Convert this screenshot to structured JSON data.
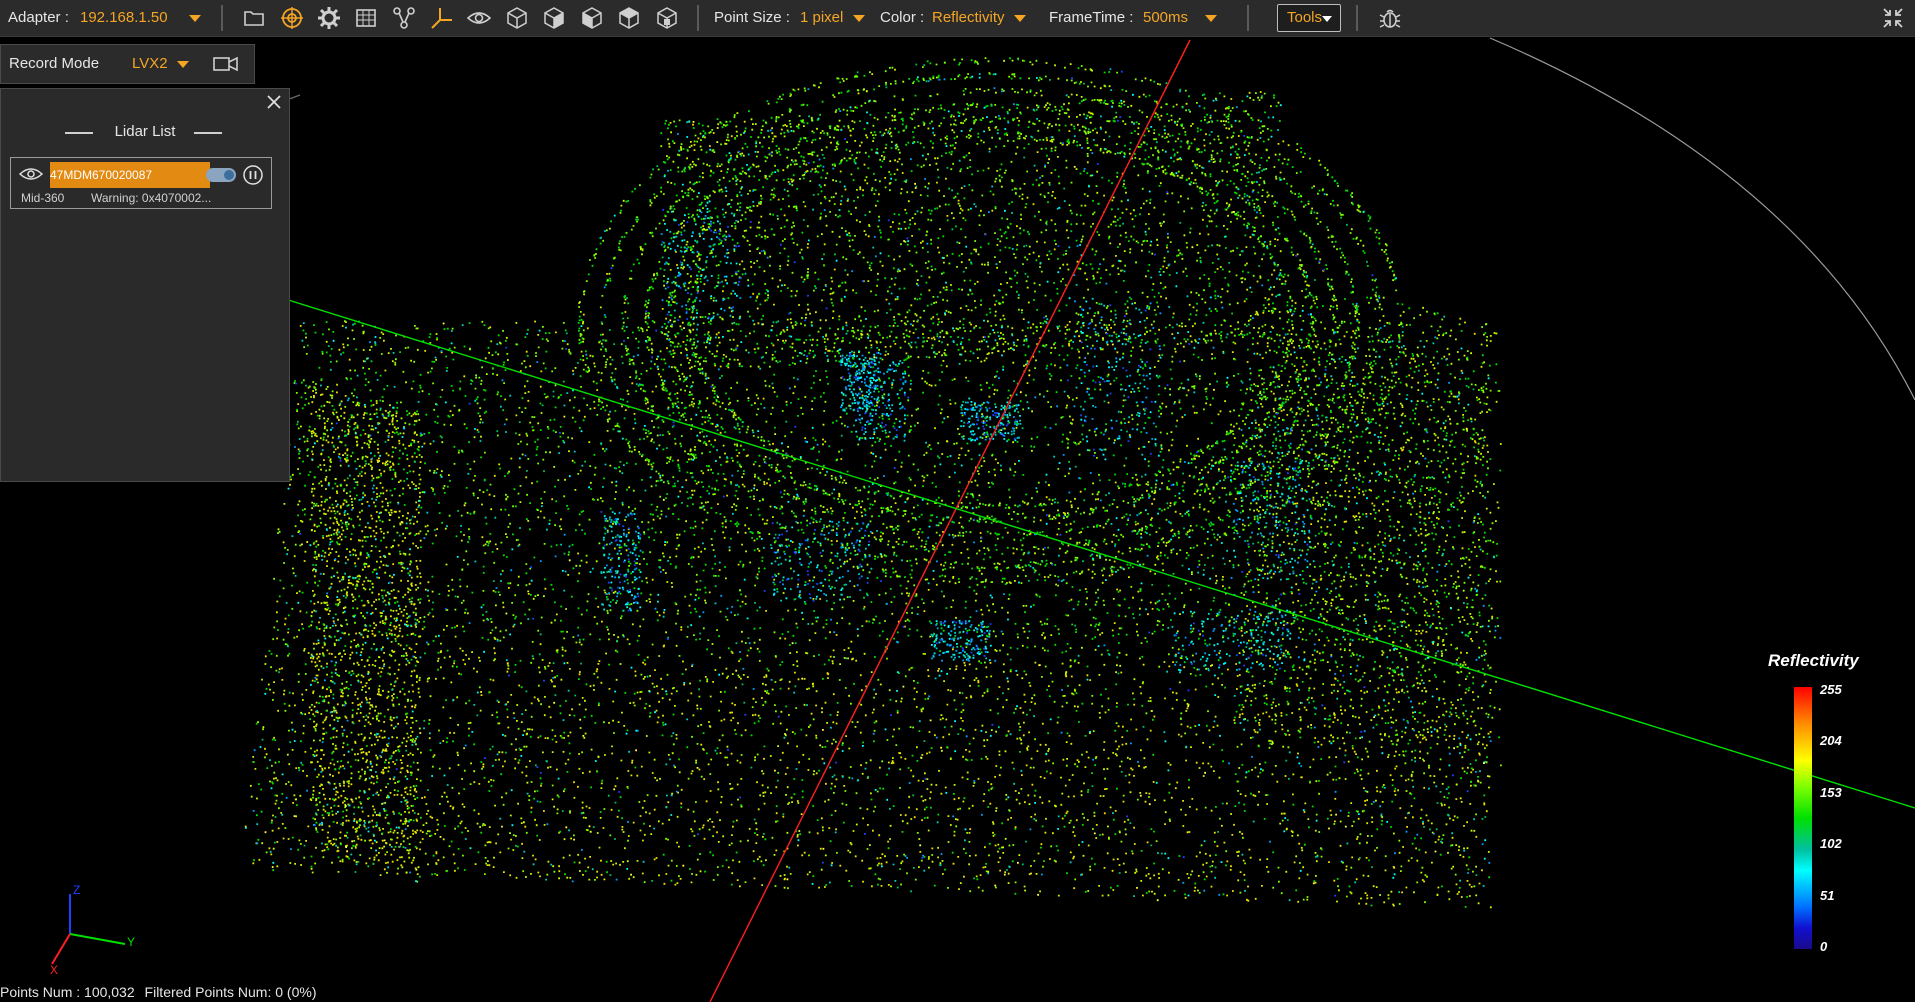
{
  "toolbar": {
    "adapter_label": "Adapter :",
    "adapter_value": "192.168.1.50",
    "icons": [
      "folder-icon",
      "target-icon",
      "gear-icon",
      "grid-icon",
      "network-icon",
      "axis-icon",
      "eye-icon",
      "cube-view-1-icon",
      "cube-view-2-icon",
      "cube-view-3-icon",
      "cube-view-4-icon",
      "cube-view-5-icon"
    ],
    "point_size_label": "Point Size :",
    "point_size_value": "1 pixel",
    "color_label": "Color :",
    "color_value": "Reflectivity",
    "frametime_label": "FrameTime :",
    "frametime_value": "500ms",
    "tools_label": "Tools",
    "bug_icon": "bug-icon",
    "fullscreen_icon": "collapse-icon"
  },
  "record": {
    "label": "Record Mode",
    "value": "LVX2",
    "icon": "video-camera-icon"
  },
  "lidar_panel": {
    "title": "Lidar List",
    "devices": [
      {
        "serial": "47MDM670020087",
        "model": "Mid-360",
        "warning": "Warning: 0x4070002..."
      }
    ]
  },
  "legend": {
    "title": "Reflectivity",
    "ticks": [
      "255",
      "204",
      "153",
      "102",
      "51",
      "0"
    ],
    "colors": [
      "#ff0000",
      "#ffff00",
      "#00e000",
      "#00ffff",
      "#0070ff",
      "#1a0a8a"
    ]
  },
  "axes": {
    "x": "X",
    "y": "Y",
    "z": "Z"
  },
  "status": {
    "points_num": "Points Num : 100,032",
    "filtered": "Filtered Points Num: 0 (0%)"
  },
  "accent_color": "#f5a524"
}
